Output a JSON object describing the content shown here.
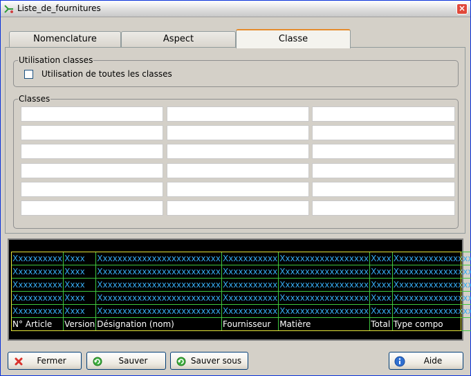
{
  "window": {
    "title": "Liste_de_fournitures"
  },
  "tabs": [
    {
      "label": "Nomenclature"
    },
    {
      "label": "Aspect"
    },
    {
      "label": "Classe"
    }
  ],
  "usage_group": {
    "label": "Utilisation classes",
    "checkbox_label": "Utilisation de toutes les classes",
    "checked": false
  },
  "classes_group": {
    "label": "Classes",
    "rows": 6,
    "cols": 3
  },
  "table": {
    "sample_rows": [
      [
        "Xxxxxxxxxx",
        "Xxxx",
        "Xxxxxxxxxxxxxxxxxxxxxxxxx",
        "Xxxxxxxxxxx",
        "Xxxxxxxxxxxxxxxxxx",
        "Xxxx",
        "Xxxxxxxxxxxxxxxxx"
      ],
      [
        "Xxxxxxxxxx",
        "Xxxx",
        "Xxxxxxxxxxxxxxxxxxxxxxxxx",
        "Xxxxxxxxxxx",
        "Xxxxxxxxxxxxxxxxxx",
        "Xxxx",
        "Xxxxxxxxxxxxxxxxx"
      ],
      [
        "Xxxxxxxxxx",
        "Xxxx",
        "Xxxxxxxxxxxxxxxxxxxxxxxxx",
        "Xxxxxxxxxxx",
        "Xxxxxxxxxxxxxxxxxx",
        "Xxxx",
        "Xxxxxxxxxxxxxxxxx"
      ],
      [
        "Xxxxxxxxxx",
        "Xxxx",
        "Xxxxxxxxxxxxxxxxxxxxxxxxx",
        "Xxxxxxxxxxx",
        "Xxxxxxxxxxxxxxxxxx",
        "Xxxx",
        "Xxxxxxxxxxxxxxxxx"
      ],
      [
        "Xxxxxxxxxx",
        "Xxxx",
        "Xxxxxxxxxxxxxxxxxxxxxxxxx",
        "Xxxxxxxxxxx",
        "Xxxxxxxxxxxxxxxxxx",
        "Xxxx",
        "Xxxxxxxxxxxxxxxxx"
      ]
    ],
    "headers": [
      "N° Article",
      "Version",
      "Désignation (nom)",
      "Fournisseur",
      "Matière",
      "Total",
      "Type compo"
    ]
  },
  "buttons": {
    "close": "Fermer",
    "save": "Sauver",
    "save_as": "Sauver sous",
    "help": "Aide"
  },
  "colors": {
    "accent_tab": "#e68b2c",
    "table_bg": "#000000",
    "table_sample_text": "#35a9f0",
    "table_grid": "#3ec63e",
    "table_border": "#e8e83a"
  },
  "icons": {
    "app": "app-icon",
    "close_window": "close-icon",
    "close_button": "x-icon",
    "save": "save-refresh-icon",
    "save_as": "save-refresh-icon",
    "help": "info-icon"
  }
}
